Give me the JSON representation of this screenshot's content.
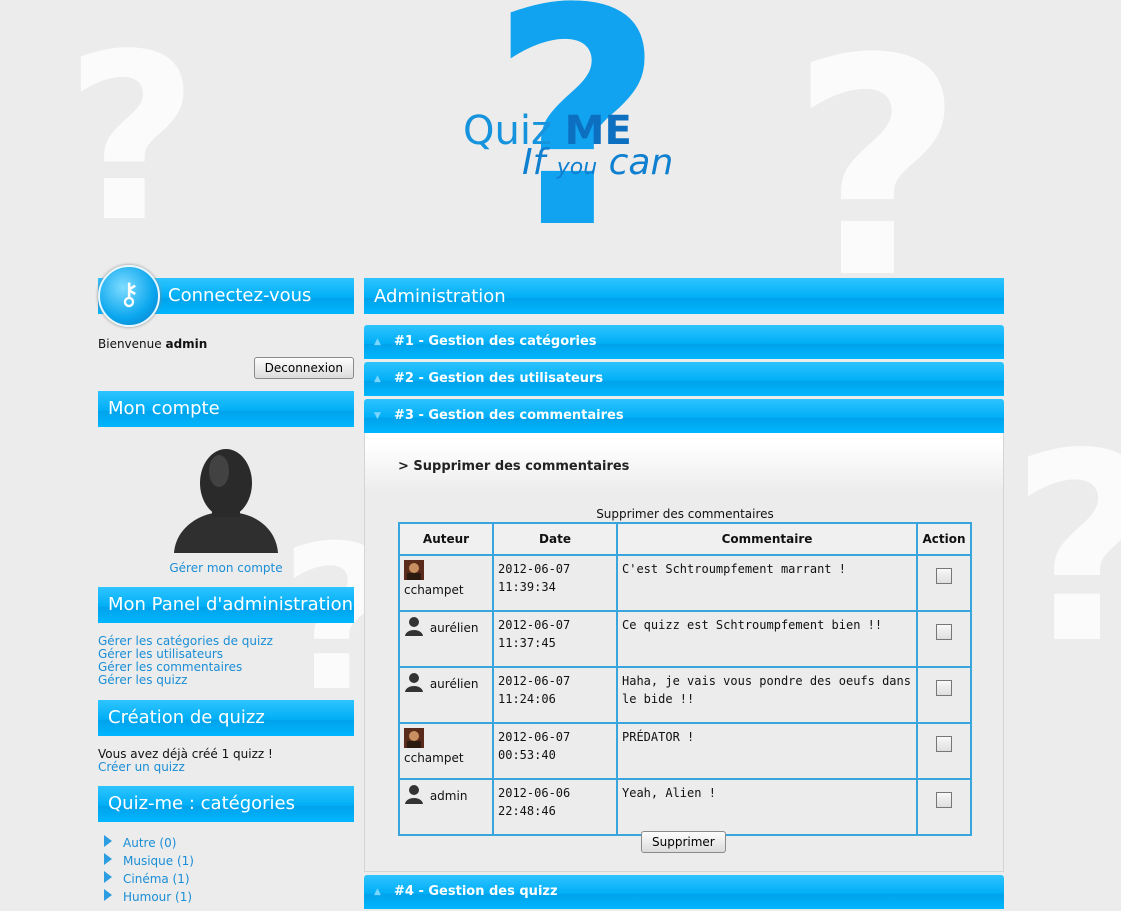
{
  "logo": {
    "word1": "Quiz",
    "word2": "ME",
    "tag_if": "If",
    "tag_you": "you",
    "tag_can": "can"
  },
  "sidebar": {
    "login": {
      "title": "Connectez-vous",
      "welcome_prefix": "Bienvenue",
      "username": "admin",
      "logout_label": "Deconnexion"
    },
    "account": {
      "title": "Mon compte",
      "manage_label": "Gérer mon compte"
    },
    "admin_panel": {
      "title": "Mon Panel d'administration",
      "links": [
        "Gérer les catégories de quizz",
        "Gérer les utilisateurs",
        "Gérer les commentaires",
        "Gérer les quizz"
      ]
    },
    "creation": {
      "title": "Création de quizz",
      "info": "Vous avez déjà créé 1 quizz !",
      "create_label": "Créer un quizz"
    },
    "categories": {
      "title": "Quiz-me : catégories",
      "items": [
        "Autre (0)",
        "Musique (1)",
        "Cinéma (1)",
        "Humour (1)"
      ]
    }
  },
  "main": {
    "title": "Administration",
    "sections": [
      "#1 - Gestion des catégories",
      "#2 - Gestion des utilisateurs",
      "#3 - Gestion des commentaires",
      "#4 - Gestion des quizz"
    ],
    "sub_heading": "> Supprimer des commentaires",
    "table": {
      "caption": "Supprimer des commentaires",
      "headers": [
        "Auteur",
        "Date",
        "Commentaire",
        "Action"
      ],
      "rows": [
        {
          "auteur": "cchampet",
          "date1": "2012-06-07",
          "date2": "11:39:34",
          "comment": "C'est Schtroumpfement marrant !",
          "avatar": "predator-avatar-icon"
        },
        {
          "auteur": "aurélien",
          "date1": "2012-06-07",
          "date2": "11:37:45",
          "comment": "Ce quizz est Schtroumpfement bien !!",
          "avatar": "user-silhouette-icon"
        },
        {
          "auteur": "aurélien",
          "date1": "2012-06-07",
          "date2": "11:24:06",
          "comment": "Haha, je vais vous pondre des oeufs dans le bide !!",
          "avatar": "user-silhouette-icon"
        },
        {
          "auteur": "cchampet",
          "date1": "2012-06-07",
          "date2": "00:53:40",
          "comment": "PRÉDATOR !",
          "avatar": "predator-avatar-icon"
        },
        {
          "auteur": "admin",
          "date1": "2012-06-06",
          "date2": "22:48:46",
          "comment": "Yeah, Alien !",
          "avatar": "user-silhouette-icon"
        }
      ]
    },
    "delete_label": "Supprimer"
  },
  "colors": {
    "accent": "#00b6ff",
    "link": "#1a8ed6",
    "table_border": "#3aa5dc"
  }
}
